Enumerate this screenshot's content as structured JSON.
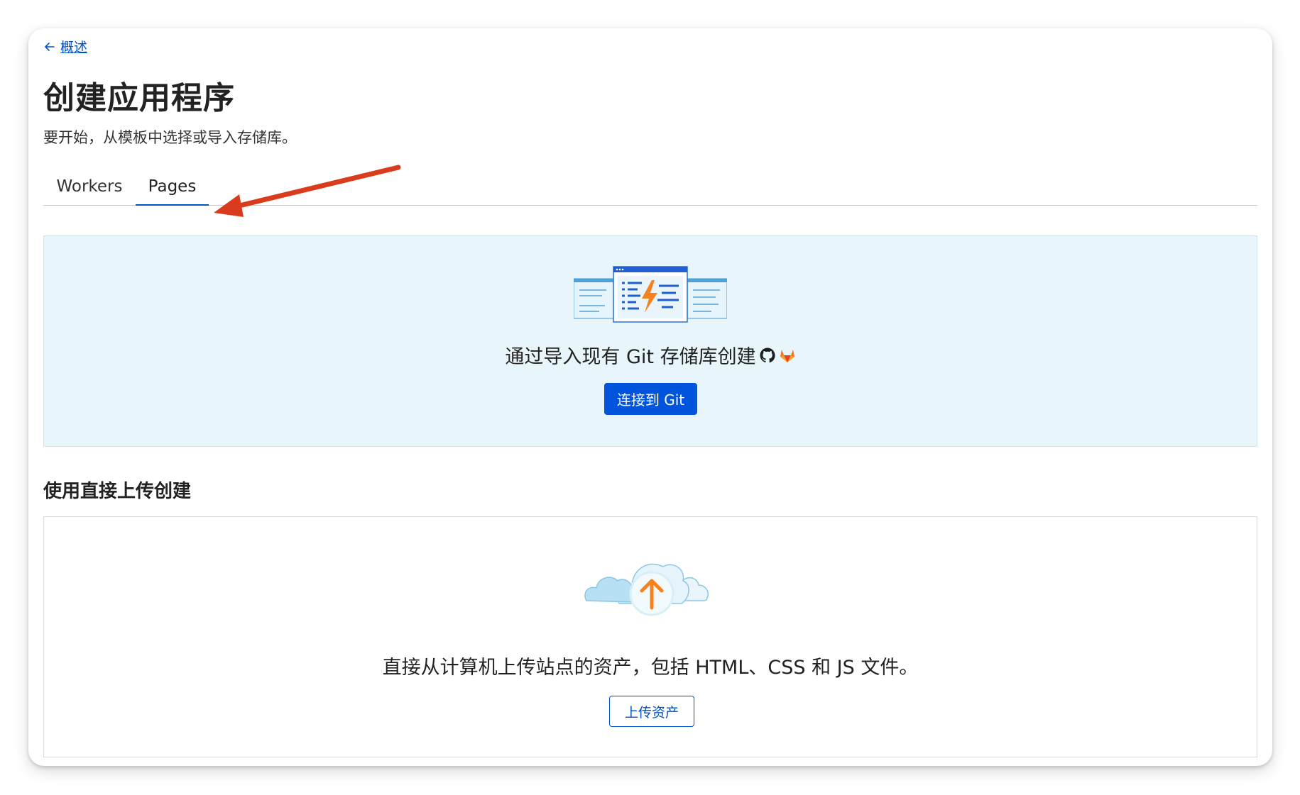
{
  "nav": {
    "back_label": "概述"
  },
  "header": {
    "title": "创建应用程序",
    "subtitle": "要开始，从模板中选择或导入存储库。"
  },
  "tabs": [
    {
      "label": "Workers",
      "active": false
    },
    {
      "label": "Pages",
      "active": true
    }
  ],
  "git_section": {
    "description": "通过导入现有 Git 存储库创建",
    "connect_button": "连接到 Git"
  },
  "upload_section": {
    "heading": "使用直接上传创建",
    "description": "直接从计算机上传站点的资产，包括 HTML、CSS 和 JS 文件。",
    "upload_button": "上传资产"
  },
  "colors": {
    "primary": "#0051c3",
    "button_fill": "#0055dc",
    "card_bg": "#e8f6fb",
    "accent_orange": "#f6821f",
    "annotation_red": "#d93b1c"
  }
}
